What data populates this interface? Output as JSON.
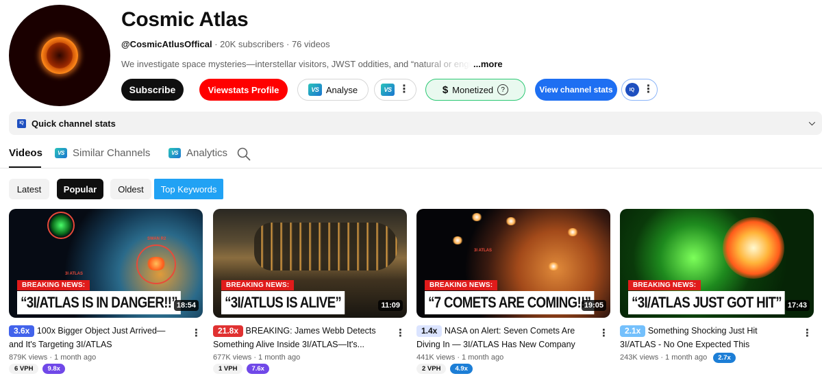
{
  "channel": {
    "name": "Cosmic Atlas",
    "handle": "@CosmicAtlusOffical",
    "subscribers": "20K subscribers",
    "videos_count": "76 videos",
    "separator": " · ",
    "description": "We investigate space mysteries—interstellar visitors, JWST oddities, and “natural or engineered”",
    "more_label": "...more"
  },
  "actions": {
    "subscribe": "Subscribe",
    "viewstats_profile": "Viewstats Profile",
    "analyse": "Analyse",
    "monetized": "Monetized",
    "view_channel_stats": "View channel stats",
    "vs_logo": "VS",
    "iq_logo": "IQ"
  },
  "quick_stats": {
    "label": "Quick channel stats"
  },
  "tabs": {
    "videos": "Videos",
    "similar": "Similar Channels",
    "analytics": "Analytics"
  },
  "chips": {
    "latest": "Latest",
    "popular": "Popular",
    "oldest": "Oldest",
    "top_keywords": "Top Keywords"
  },
  "videos": [
    {
      "breaking": "BREAKING NEWS:",
      "headline": "“3I/ATLAS IS IN DANGER!!”",
      "duration": "18:54",
      "multiplier": "3.6x",
      "multiplier_color": "#3b5bdb",
      "multiplier_bg": "#dbe4ff",
      "title": "100x Bigger Object Just Arrived—and It's Targeting 3I/ATLAS",
      "views": "879K views",
      "age": "1 month ago",
      "vph": "6 VPH",
      "ratio": "9.8x",
      "ratio_color": "#7048e8"
    },
    {
      "breaking": "BREAKING NEWS:",
      "headline": "“3I/ATLUS IS ALIVE”",
      "duration": "11:09",
      "multiplier": "21.8x",
      "multiplier_color": "#ffffff",
      "multiplier_bg": "#e03131",
      "title": "BREAKING: James Webb Detects Something Alive Inside 3I/ATLAS—It's...",
      "views": "677K views",
      "age": "1 month ago",
      "vph": "1 VPH",
      "ratio": "7.6x",
      "ratio_color": "#7048e8"
    },
    {
      "breaking": "BREAKING NEWS:",
      "headline": "“7 COMETS ARE COMING!!”",
      "duration": "19:05",
      "multiplier": "1.4x",
      "multiplier_color": "#0f0f0f",
      "multiplier_bg": "#dbe4ff",
      "title": "NASA on Alert: Seven Comets Are Diving In — 3I/ATLAS Has New Company",
      "views": "441K views",
      "age": "1 month ago",
      "vph": "2 VPH",
      "ratio": "4.9x",
      "ratio_color": "#1c7ed6"
    },
    {
      "breaking": "BREAKING NEWS:",
      "headline": "“3I/ATLAS JUST GOT HIT”",
      "duration": "17:43",
      "multiplier": "2.1x",
      "multiplier_color": "#ffffff",
      "multiplier_bg": "#74c0fc",
      "title": "Something Shocking Just Hit 3I/ATLAS - No One Expected This",
      "views": "243K views",
      "age": "1 month ago",
      "vph": "",
      "ratio": "2.7x",
      "ratio_color": "#1c7ed6"
    }
  ],
  "thumb_labels": {
    "v1_swan": "SWAN R2",
    "v1_atlas": "3I ATLAS",
    "v3_atlas": "3I ATLAS"
  }
}
